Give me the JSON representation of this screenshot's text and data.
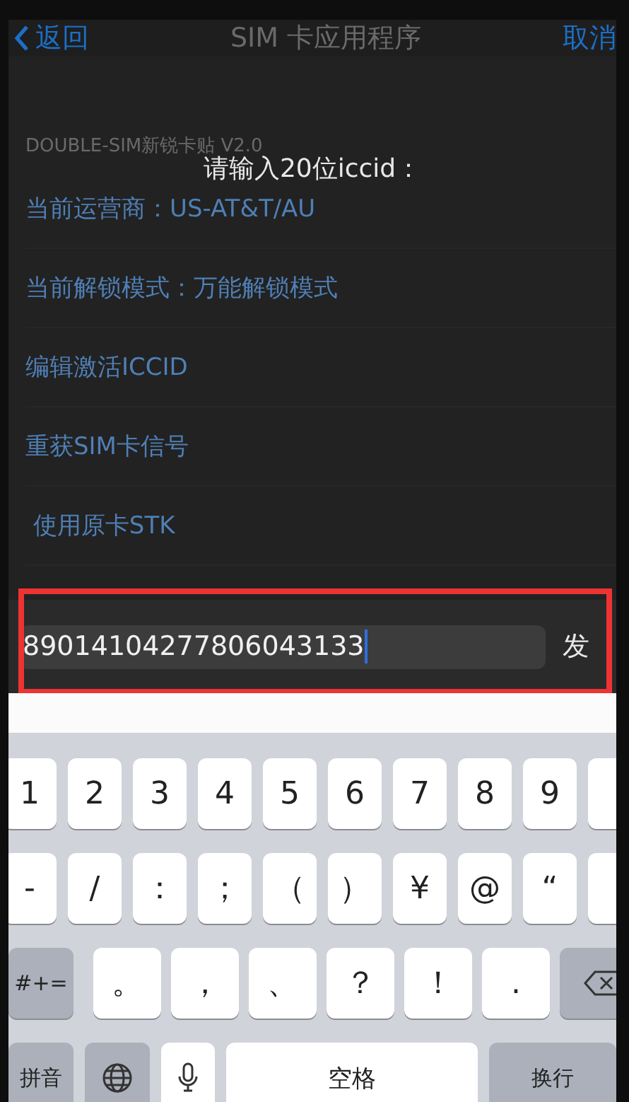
{
  "nav": {
    "back": "返回",
    "title": "SIM 卡应用程序",
    "cancel": "取消"
  },
  "section_header": "DOUBLE-SIM新锐卡贴 V2.0",
  "dialog": {
    "prompt": "请输入20位iccid："
  },
  "rows": [
    {
      "label": "当前运营商：US-AT&T/AU"
    },
    {
      "label": "当前解锁模式：万能解锁模式"
    },
    {
      "label": "编辑激活ICCID"
    },
    {
      "label": "重获SIM卡信号"
    },
    {
      "label": " 使用原卡STK"
    }
  ],
  "input_bar": {
    "value": "89014104277806043133",
    "send": "发"
  },
  "keyboard": {
    "rows": [
      {
        "kind": "narrow",
        "keys": [
          {
            "kind": "char",
            "label": "1"
          },
          {
            "kind": "char",
            "label": "2"
          },
          {
            "kind": "char",
            "label": "3"
          },
          {
            "kind": "char",
            "label": "4"
          },
          {
            "kind": "char",
            "label": "5"
          },
          {
            "kind": "char",
            "label": "6"
          },
          {
            "kind": "char",
            "label": "7"
          },
          {
            "kind": "char",
            "label": "8"
          },
          {
            "kind": "char",
            "label": "9"
          },
          {
            "kind": "blank"
          }
        ]
      },
      {
        "kind": "narrow",
        "keys": [
          {
            "kind": "char",
            "label": "-"
          },
          {
            "kind": "char",
            "label": "/"
          },
          {
            "kind": "char",
            "label": "："
          },
          {
            "kind": "char",
            "label": "；"
          },
          {
            "kind": "char",
            "label": "（"
          },
          {
            "kind": "char",
            "label": "）"
          },
          {
            "kind": "char",
            "label": "¥"
          },
          {
            "kind": "char",
            "label": "@"
          },
          {
            "kind": "char",
            "label": "“"
          },
          {
            "kind": "blank"
          }
        ]
      },
      {
        "kind": "wide",
        "keys": [
          {
            "kind": "function",
            "label": "#+="
          },
          {
            "kind": "char",
            "label": "。"
          },
          {
            "kind": "char",
            "label": "，"
          },
          {
            "kind": "char",
            "label": "、"
          },
          {
            "kind": "char",
            "label": "？"
          },
          {
            "kind": "char",
            "label": "！"
          },
          {
            "kind": "char",
            "label": "."
          },
          {
            "kind": "delete"
          }
        ]
      },
      {
        "kind": "bottom",
        "keys": [
          {
            "kind": "function",
            "label": "拼音"
          },
          {
            "kind": "globe"
          },
          {
            "kind": "mic"
          },
          {
            "kind": "space",
            "label": "空格"
          },
          {
            "kind": "function",
            "label": "换行"
          }
        ]
      }
    ]
  }
}
